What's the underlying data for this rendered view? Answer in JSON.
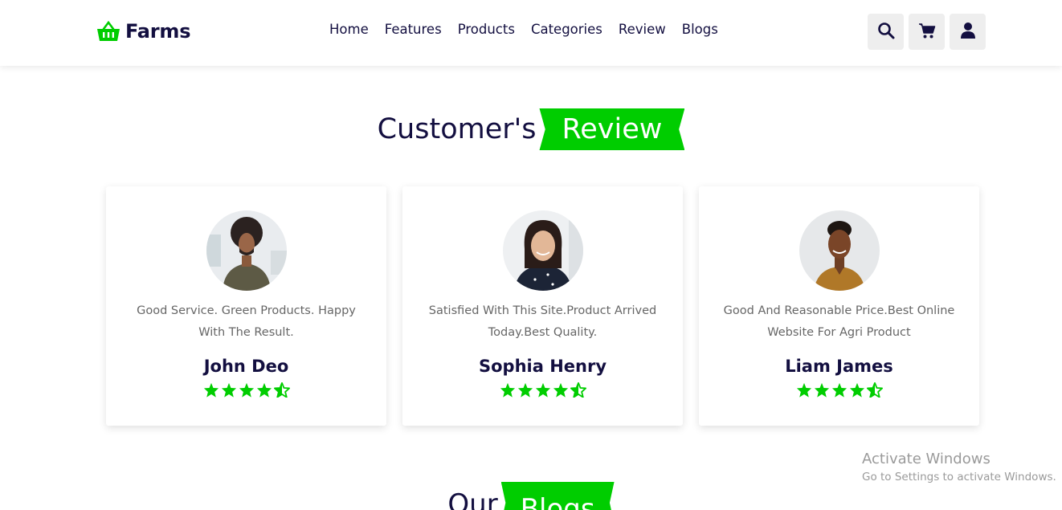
{
  "brand": {
    "name": "Farms",
    "logo_icon": "basket-icon",
    "accent": "#00cd00",
    "text_color": "#130f40"
  },
  "nav": {
    "items": [
      {
        "label": "Home"
      },
      {
        "label": "Features"
      },
      {
        "label": "Products"
      },
      {
        "label": "Categories"
      },
      {
        "label": "Review"
      },
      {
        "label": "Blogs"
      }
    ]
  },
  "header_icons": [
    "search-icon",
    "cart-icon",
    "user-icon"
  ],
  "review_section": {
    "title_main": "Customer's",
    "title_flag": "Review",
    "reviews": [
      {
        "text": "Good Service. Green Products. Happy With The Result.",
        "name": "John Deo",
        "rating": 4.5
      },
      {
        "text": "Satisfied With This Site.Product Arrived Today.Best Quality.",
        "name": "Sophia Henry",
        "rating": 4.5
      },
      {
        "text": "Good And Reasonable Price.Best Online Website For Agri Product",
        "name": "Liam James",
        "rating": 4.5
      }
    ]
  },
  "blogs_section": {
    "title_main": "Our",
    "title_flag": "Blogs"
  },
  "watermark": {
    "title": "Activate Windows",
    "subtitle": "Go to Settings to activate Windows."
  }
}
